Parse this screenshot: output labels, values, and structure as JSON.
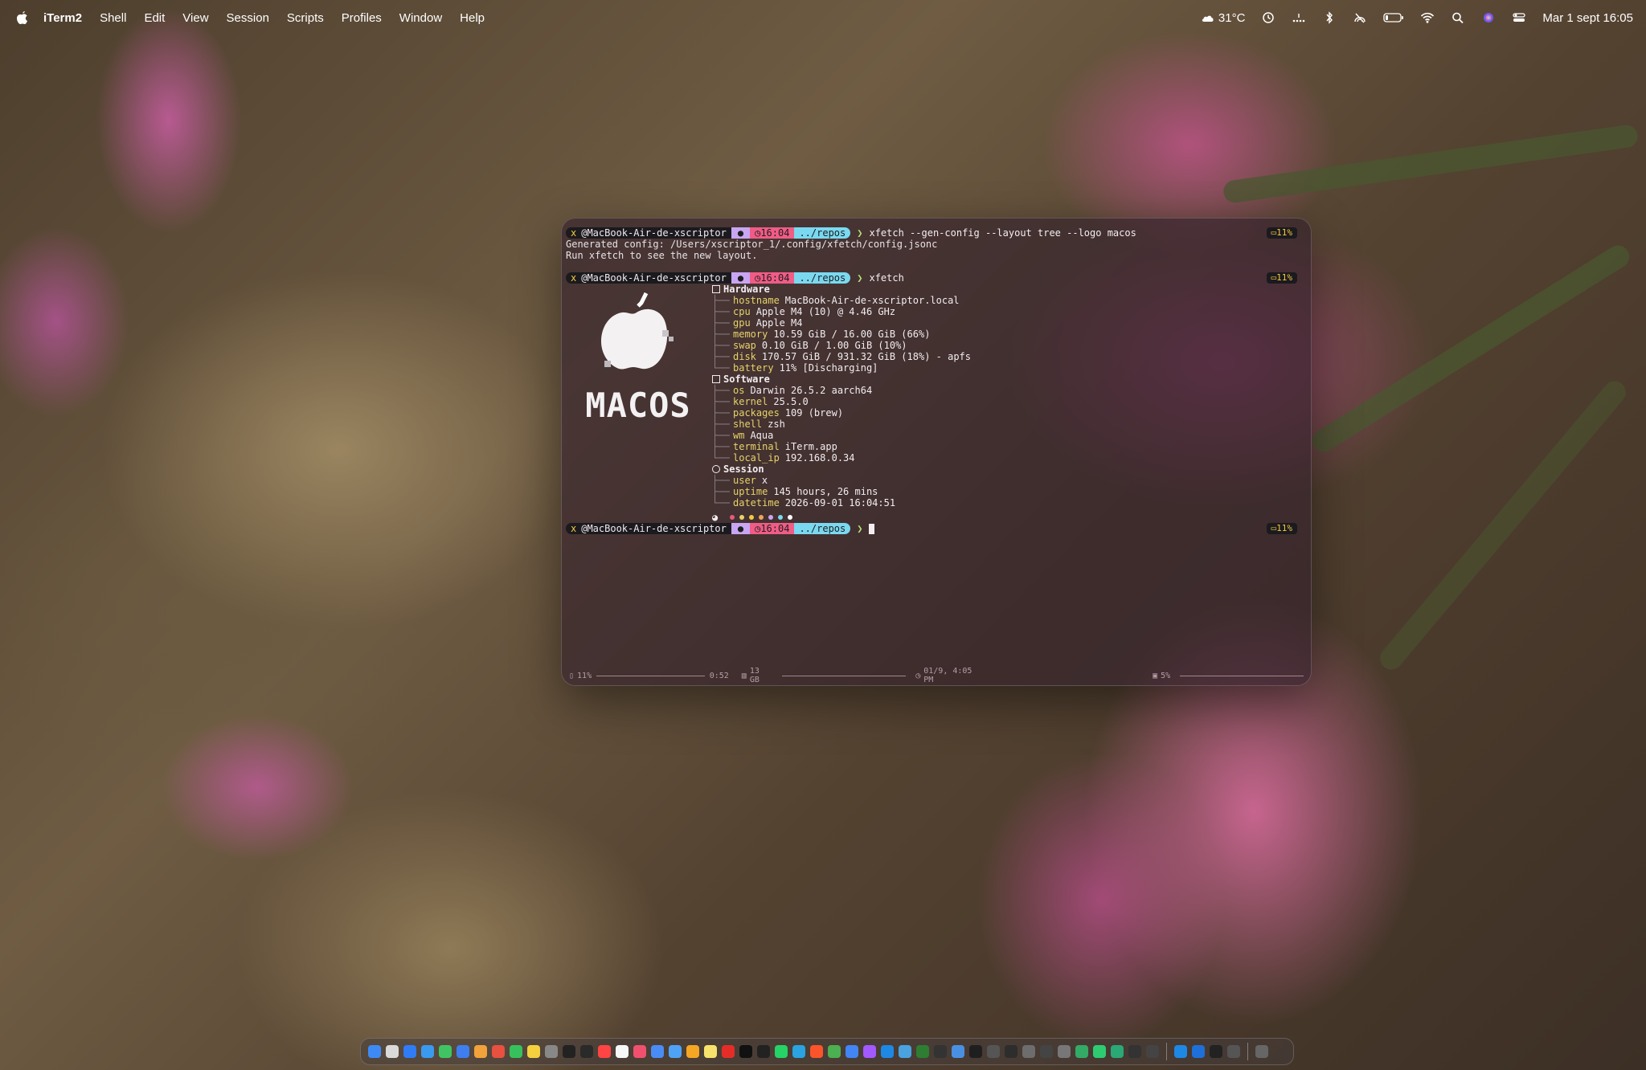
{
  "menubar": {
    "app_name": "iTerm2",
    "menus": [
      "Shell",
      "Edit",
      "View",
      "Session",
      "Scripts",
      "Profiles",
      "Window",
      "Help"
    ],
    "weather": "31°C",
    "datetime": "Mar 1 sept 16:05"
  },
  "terminal": {
    "prompt": {
      "user": "@MacBook-Air-de-xscriptor",
      "x_marker": "x",
      "time": "16:04",
      "dir": "../repos",
      "battery": "11%"
    },
    "commands": [
      "xfetch --gen-config --layout tree --logo macos",
      "xfetch"
    ],
    "output_lines": [
      "Generated config: /Users/xscriptor_1/.config/xfetch/config.jsonc",
      "Run xfetch to see the new layout."
    ],
    "logo_text": "MACOS",
    "hardware": {
      "title": "Hardware",
      "rows": [
        {
          "key": "hostname",
          "value": "MacBook-Air-de-xscriptor.local"
        },
        {
          "key": "cpu",
          "value": "Apple M4 (10) @ 4.46 GHz"
        },
        {
          "key": "gpu",
          "value": "Apple M4"
        },
        {
          "key": "memory",
          "value": "10.59 GiB / 16.00 GiB (66%)"
        },
        {
          "key": "swap",
          "value": "0.10 GiB / 1.00 GiB (10%)"
        },
        {
          "key": "disk",
          "value": "170.57 GiB / 931.32 GiB (18%) - apfs"
        },
        {
          "key": "battery",
          "value": "11% [Discharging]"
        }
      ]
    },
    "software": {
      "title": "Software",
      "rows": [
        {
          "key": "os",
          "value": "Darwin 26.5.2 aarch64"
        },
        {
          "key": "kernel",
          "value": "25.5.0"
        },
        {
          "key": "packages",
          "value": "109 (brew)"
        },
        {
          "key": "shell",
          "value": "zsh"
        },
        {
          "key": "wm",
          "value": "Aqua"
        },
        {
          "key": "terminal",
          "value": "iTerm.app"
        },
        {
          "key": "local_ip",
          "value": "192.168.0.34"
        }
      ]
    },
    "session": {
      "title": "Session",
      "rows": [
        {
          "key": "user",
          "value": "x"
        },
        {
          "key": "uptime",
          "value": "145 hours, 26 mins"
        },
        {
          "key": "datetime",
          "value": "2026-09-01 16:04:51"
        }
      ]
    },
    "palette": [
      "#e85a7a",
      "#e6d36a",
      "#f4c842",
      "#f0a35c",
      "#c8a6f2",
      "#7ad9f0",
      "#ffffff"
    ],
    "statusbar": {
      "battery": "11%",
      "battery_time": "0:52",
      "memory": "13 GB",
      "clock": "01/9, 4:05 PM",
      "cpu": "5%"
    }
  },
  "colors": {
    "prompt_time": "#f05c86",
    "prompt_dir": "#7ad9f0",
    "prompt_os": "#c8a6f2",
    "key_yellow": "#e6d36a"
  },
  "dock": {
    "icons": [
      "finder-icon",
      "launchpad-icon",
      "app-store-icon",
      "safari-icon",
      "messages-icon",
      "mail-icon",
      "photos-icon",
      "chrome-icon",
      "facetime-icon",
      "notes-icon",
      "calculator-icon",
      "terminal-icon",
      "iterm-icon",
      "calendar-icon",
      "reminders-icon",
      "music-icon",
      "xcode-icon",
      "files-icon",
      "pages-icon",
      "stickies-icon",
      "youtube-icon",
      "tv-icon",
      "github-icon",
      "whatsapp-icon",
      "telegram-icon",
      "brave-icon",
      "maps-icon",
      "chrome2-icon",
      "figma-icon",
      "vscode-icon",
      "zed-icon",
      "vim-icon",
      "font-icon",
      "browser-icon",
      "cursor-icon",
      "monitor-icon",
      "display-icon",
      "tool-icon",
      "window-icon",
      "settings-icon",
      "activity-icon",
      "phone-icon",
      "sheets-icon",
      "obs-icon",
      "a-icon",
      "vscode2-icon",
      "safari2-icon",
      "terminal2-icon",
      "screen-icon",
      "trash-icon"
    ]
  }
}
